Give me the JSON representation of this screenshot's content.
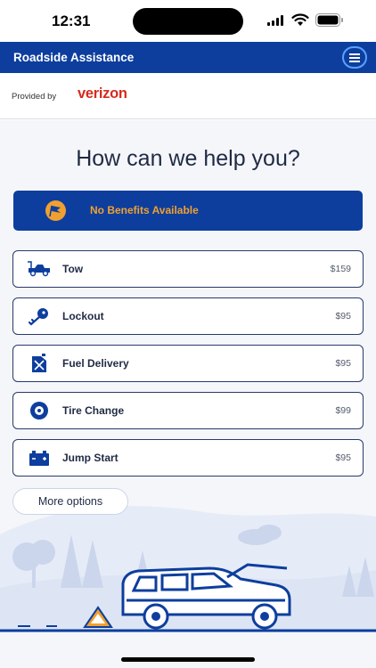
{
  "status_bar": {
    "time": "12:31"
  },
  "header": {
    "title": "Roadside Assistance"
  },
  "provider": {
    "provided_by": "Provided by",
    "brand": "verizon"
  },
  "main": {
    "headline": "How can we help you?",
    "benefits_banner": "No Benefits Available",
    "services": [
      {
        "label": "Tow",
        "price": "$159",
        "icon": "tow-truck-icon"
      },
      {
        "label": "Lockout",
        "price": "$95",
        "icon": "key-icon"
      },
      {
        "label": "Fuel Delivery",
        "price": "$95",
        "icon": "fuel-can-icon"
      },
      {
        "label": "Tire Change",
        "price": "$99",
        "icon": "tire-icon"
      },
      {
        "label": "Jump Start",
        "price": "$95",
        "icon": "battery-icon"
      }
    ],
    "more_options": "More options"
  },
  "colors": {
    "brand_blue": "#0d3e9e",
    "accent_orange": "#f0a030",
    "verizon_red": "#d52b1e",
    "background": "#f5f6fa"
  }
}
